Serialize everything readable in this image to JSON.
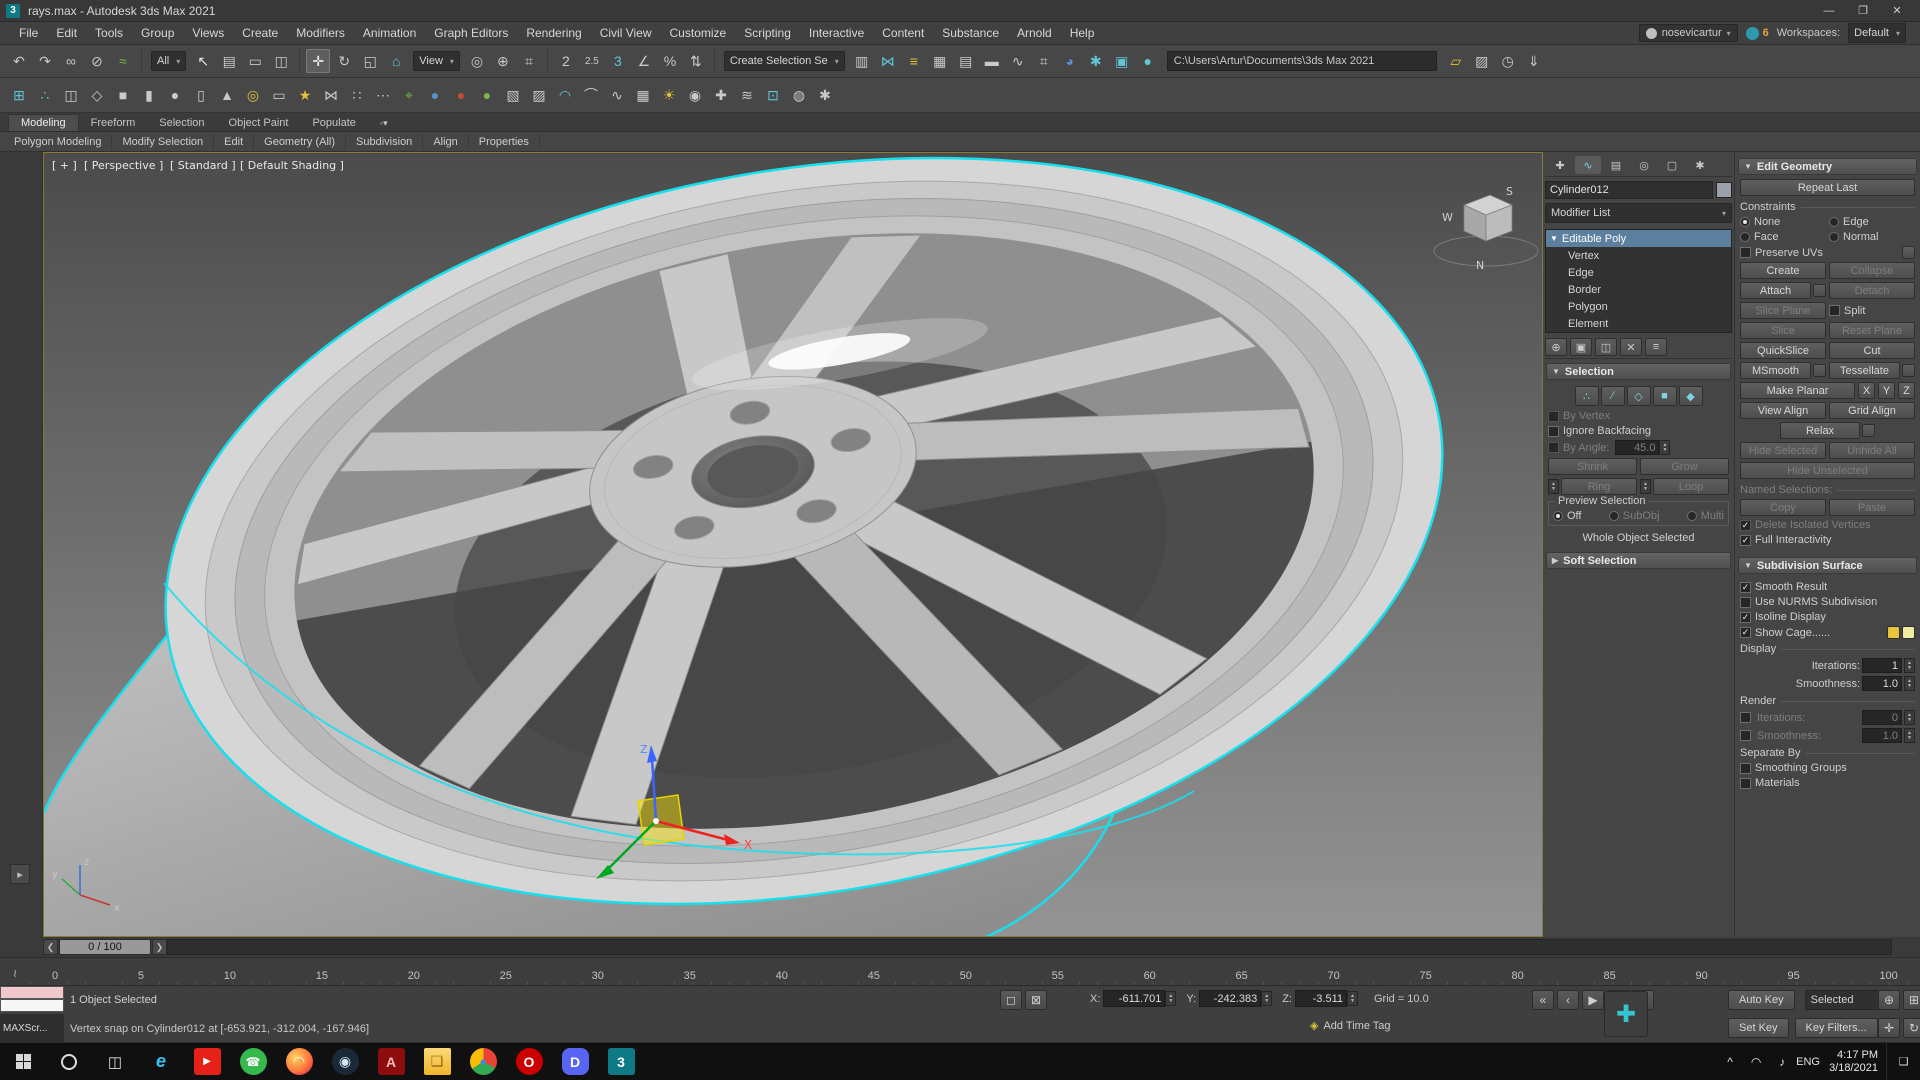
{
  "colors": {
    "accent_cyan": "#17e0ee",
    "autokey_red": "#b03030",
    "panel": "#454545"
  },
  "titlebar": {
    "title": "rays.max - Autodesk 3ds Max 2021",
    "app_glyph": "3",
    "min": "—",
    "max": "❐",
    "close": "✕"
  },
  "menubar": {
    "items": [
      {
        "n": "menu-file",
        "t": "File"
      },
      {
        "n": "menu-edit",
        "t": "Edit"
      },
      {
        "n": "menu-tools",
        "t": "Tools"
      },
      {
        "n": "menu-group",
        "t": "Group"
      },
      {
        "n": "menu-views",
        "t": "Views"
      },
      {
        "n": "menu-create",
        "t": "Create"
      },
      {
        "n": "menu-modifiers",
        "t": "Modifiers"
      },
      {
        "n": "menu-animation",
        "t": "Animation"
      },
      {
        "n": "menu-graph-editors",
        "t": "Graph Editors"
      },
      {
        "n": "menu-rendering",
        "t": "Rendering"
      },
      {
        "n": "menu-civil-view",
        "t": "Civil View"
      },
      {
        "n": "menu-customize",
        "t": "Customize"
      },
      {
        "n": "menu-scripting",
        "t": "Scripting"
      },
      {
        "n": "menu-interactive",
        "t": "Interactive"
      },
      {
        "n": "menu-content",
        "t": "Content"
      },
      {
        "n": "menu-substance",
        "t": "Substance"
      },
      {
        "n": "menu-arnold",
        "t": "Arnold"
      },
      {
        "n": "menu-help",
        "t": "Help"
      }
    ],
    "user": "nosevicartur",
    "user_arrow": "▾",
    "badge": "6",
    "workspaces_label": "Workspaces:",
    "workspace": "Default",
    "workspace_arrow": "▾"
  },
  "toolbar1": {
    "g1": [
      {
        "n": "undo-icon",
        "g": "↶"
      },
      {
        "n": "redo-icon",
        "g": "↷"
      },
      {
        "n": "select-and-link-icon",
        "g": "∞"
      },
      {
        "n": "unlink-selection-icon",
        "g": "⊘"
      },
      {
        "n": "bind-to-space-warp-icon",
        "g": "≈",
        "s": "color:#7ab648"
      }
    ],
    "filter_all": "All",
    "g2": [
      {
        "n": "select-object-icon",
        "g": "↖",
        "s": "color:#e8e8e8"
      },
      {
        "n": "select-by-name-icon",
        "g": "▤"
      },
      {
        "n": "rectangular-selection-region-icon",
        "g": "▭"
      },
      {
        "n": "window-crossing-toggle-icon",
        "g": "◫"
      }
    ],
    "g3": [
      {
        "n": "select-and-move-icon",
        "g": "✛",
        "s": "background:#5e5e5e;box-shadow:inset 0 0 0 1px #7a7a7a;color:#f0f0f0"
      },
      {
        "n": "select-and-rotate-icon",
        "g": "↻"
      },
      {
        "n": "select-and-scale-icon",
        "g": "◱"
      },
      {
        "n": "select-and-place-icon",
        "g": "⌂",
        "s": "color:#62c6d4"
      }
    ],
    "view_dd": "View",
    "g4": [
      {
        "n": "use-pivot-point-center-icon",
        "g": "◎"
      },
      {
        "n": "select-and-manipulate-icon",
        "g": "⊕"
      },
      {
        "n": "keyboard-shortcut-override-icon",
        "g": "⌗"
      }
    ],
    "g5": [
      {
        "n": "snaps-toggle-2d-icon",
        "g": "2"
      },
      {
        "n": "snaps-toggle-25d-icon",
        "g": "2.5",
        "s": "font-size:10px"
      },
      {
        "n": "snaps-toggle-3d-icon",
        "g": "3",
        "s": "color:#62c6d4"
      },
      {
        "n": "angle-snap-toggle-icon",
        "g": "∠"
      },
      {
        "n": "percent-snap-toggle-icon",
        "g": "%"
      },
      {
        "n": "spinner-snap-toggle-icon",
        "g": "⇅"
      }
    ],
    "create_selection_dd": "Create Selection Se",
    "g6": [
      {
        "n": "edit-named-selection-sets-icon",
        "g": "▥"
      },
      {
        "n": "mirror-icon",
        "g": "⋈",
        "s": "color:#62c6d4"
      },
      {
        "n": "align-icon",
        "g": "≡",
        "s": "color:#e0c23a"
      },
      {
        "n": "toggle-scene-explorer-icon",
        "g": "▦"
      },
      {
        "n": "toggle-layer-explorer-icon",
        "g": "▤"
      },
      {
        "n": "toggle-ribbon-icon",
        "g": "▬"
      },
      {
        "n": "curve-editor-icon",
        "g": "∿"
      },
      {
        "n": "schematic-view-icon",
        "g": "⌗"
      },
      {
        "n": "material-editor-icon",
        "g": "◕",
        "s": "color:#5d8fd0"
      },
      {
        "n": "render-setup-icon",
        "g": "✱",
        "s": "color:#62c6d4"
      },
      {
        "n": "rendered-frame-window-icon",
        "g": "▣",
        "s": "color:#62c6d4"
      },
      {
        "n": "render-production-icon",
        "g": "●",
        "s": "color:#62c6d4"
      }
    ],
    "path": "C:\\Users\\Artur\\Documents\\3ds Max 2021",
    "g7": [
      {
        "n": "project-folder-icon",
        "g": "▱",
        "s": "color:#e0c23a"
      },
      {
        "n": "asset-library-icon",
        "g": "▨"
      },
      {
        "n": "open-recent-icon",
        "g": "◷"
      },
      {
        "n": "save-scene-icon",
        "g": "⇓"
      }
    ]
  },
  "toolbar2": {
    "icons": [
      {
        "n": "snap-to-grid-icon",
        "g": "⊞",
        "s": "color:#62c6d4"
      },
      {
        "n": "snap-to-vertex-icon",
        "g": "∴",
        "s": "color:#62c6d4"
      },
      {
        "n": "viewport-layout-icon",
        "g": "◫"
      },
      {
        "n": "wireframe-toggle-icon",
        "g": "◇"
      },
      {
        "n": "box-primitive-icon",
        "g": "■"
      },
      {
        "n": "cylinder-primitive-icon",
        "g": "▮"
      },
      {
        "n": "sphere-primitive-icon",
        "g": "●"
      },
      {
        "n": "capsule-primitive-icon",
        "g": "▯"
      },
      {
        "n": "cone-primitive-icon",
        "g": "▲"
      },
      {
        "n": "torus-primitive-icon",
        "g": "◎",
        "s": "color:#e0c23a"
      },
      {
        "n": "plane-primitive-icon",
        "g": "▭"
      },
      {
        "n": "star-shape-icon",
        "g": "★",
        "s": "color:#e0c23a"
      },
      {
        "n": "mirror-modifier-icon",
        "g": "⋈"
      },
      {
        "n": "array-tool-icon",
        "g": "∷"
      },
      {
        "n": "spacing-tool-icon",
        "g": "⋯"
      },
      {
        "n": "measure-distance-icon",
        "g": "⌖",
        "s": "color:#7ab648"
      },
      {
        "n": "material-sample-blue-icon",
        "g": "●",
        "s": "color:#5d8fd0"
      },
      {
        "n": "material-sample-red-icon",
        "g": "●",
        "s": "color:#c34b3a"
      },
      {
        "n": "material-sample-green-icon",
        "g": "●",
        "s": "color:#7ab648"
      },
      {
        "n": "uvw-map-icon",
        "g": "▧"
      },
      {
        "n": "unwrap-uvw-icon",
        "g": "▨"
      },
      {
        "n": "smooth-modifier-icon",
        "g": "◠",
        "s": "color:#62c6d4"
      },
      {
        "n": "bend-modifier-icon",
        "g": "⌒"
      },
      {
        "n": "twist-modifier-icon",
        "g": "∿"
      },
      {
        "n": "lattice-modifier-icon",
        "g": "▦"
      },
      {
        "n": "light-create-icon",
        "g": "☀",
        "s": "color:#e0c23a"
      },
      {
        "n": "camera-create-icon",
        "g": "◉"
      },
      {
        "n": "helper-create-icon",
        "g": "✚"
      },
      {
        "n": "space-warp-icon",
        "g": "≋"
      },
      {
        "n": "render-region-icon",
        "g": "⊡",
        "s": "color:#62c6d4"
      },
      {
        "n": "environment-settings-icon",
        "g": "◍"
      },
      {
        "n": "viewport-config-icon",
        "g": "✱"
      }
    ]
  },
  "ribbon": {
    "tabs": [
      {
        "n": "ribbon-tab-modeling",
        "t": "Modeling",
        "s": "background:#4d4d4d;color:#eee;border:1px solid #333;border-bottom:none"
      },
      {
        "n": "ribbon-tab-freeform",
        "t": "Freeform"
      },
      {
        "n": "ribbon-tab-selection",
        "t": "Selection"
      },
      {
        "n": "ribbon-tab-object-paint",
        "t": "Object Paint"
      },
      {
        "n": "ribbon-tab-populate",
        "t": "Populate"
      }
    ],
    "options_glyph": "◦▾",
    "subtabs": [
      {
        "n": "ribbon-panel-polygon-modeling",
        "t": "Polygon Modeling"
      },
      {
        "n": "ribbon-panel-modify-selection",
        "t": "Modify Selection"
      },
      {
        "n": "ribbon-panel-edit",
        "t": "Edit"
      },
      {
        "n": "ribbon-panel-geometry-all",
        "t": "Geometry (All)"
      },
      {
        "n": "ribbon-panel-subdivision",
        "t": "Subdivision"
      },
      {
        "n": "ribbon-panel-align",
        "t": "Align"
      },
      {
        "n": "ribbon-panel-properties",
        "t": "Properties"
      }
    ]
  },
  "viewport": {
    "label_plus": "[ + ]",
    "label_camera": "[ Perspective ]",
    "label_renderer": "[ Standard ]",
    "label_shading": "[ Default Shading ]",
    "viewcube": {
      "w": "W",
      "n": "N",
      "s": "S"
    },
    "axis": {
      "x": "x",
      "y": "y",
      "z": "z"
    },
    "gizmo_x": "X",
    "gizmo_z": "Z"
  },
  "command_panel": {
    "tabs": [
      {
        "n": "create-tab-icon",
        "g": "✚"
      },
      {
        "n": "modify-tab-icon",
        "g": "∿",
        "s": "background:#5a5a5a;color:#7fd4e0"
      },
      {
        "n": "hierarchy-tab-icon",
        "g": "▤"
      },
      {
        "n": "motion-tab-icon",
        "g": "◎"
      },
      {
        "n": "display-tab-icon",
        "g": "▢"
      },
      {
        "n": "utilities-tab-icon",
        "g": "✱"
      }
    ],
    "object_name": "Cylinder012",
    "modifier_list": "Modifier List",
    "stack_root": "Editable Poly",
    "stack_sub": [
      "Vertex",
      "Edge",
      "Border",
      "Polygon",
      "Element"
    ],
    "stack_tools": [
      {
        "n": "pin-stack-icon",
        "g": "⊕"
      },
      {
        "n": "show-end-result-icon",
        "g": "▣"
      },
      {
        "n": "make-unique-icon",
        "g": "◫"
      },
      {
        "n": "remove-modifier-icon",
        "g": "✕"
      },
      {
        "n": "configure-modifier-sets-icon",
        "g": "≡"
      }
    ],
    "selection": {
      "title": "Selection",
      "sub_icons": [
        {
          "n": "vertex-mode-icon",
          "g": "∴"
        },
        {
          "n": "edge-mode-icon",
          "g": "∕"
        },
        {
          "n": "border-mode-icon",
          "g": "◇"
        },
        {
          "n": "polygon-mode-icon",
          "g": "■"
        },
        {
          "n": "element-mode-icon",
          "g": "◆"
        }
      ],
      "by_vertex": "By Vertex",
      "ignore_backfacing": "Ignore Backfacing",
      "by_angle": "By Angle:",
      "by_angle_value": "45.0",
      "shrink": "Shrink",
      "grow": "Grow",
      "ring": "Ring",
      "loop": "Loop",
      "preview": "Preview Selection",
      "off": "Off",
      "subobj": "SubObj",
      "multi": "Multi",
      "status": "Whole Object Selected"
    },
    "soft_selection": "Soft Selection",
    "edit_geometry": {
      "title": "Edit Geometry",
      "repeat_last": "Repeat Last",
      "constraints": "Constraints",
      "none": "None",
      "edge": "Edge",
      "face": "Face",
      "normal": "Normal",
      "preserve_uvs": "Preserve UVs",
      "create": "Create",
      "collapse": "Collapse",
      "attach": "Attach",
      "detach": "Detach",
      "slice_plane": "Slice Plane",
      "split": "Split",
      "slice": "Slice",
      "reset_plane": "Reset Plane",
      "quickslice": "QuickSlice",
      "cut": "Cut",
      "msmooth": "MSmooth",
      "tessellate": "Tessellate",
      "make_planar": "Make Planar",
      "x": "X",
      "y": "Y",
      "z": "Z",
      "view_align": "View Align",
      "grid_align": "Grid Align",
      "relax": "Relax",
      "hide_selected": "Hide Selected",
      "unhide_all": "Unhide All",
      "hide_unselected": "Hide Unselected",
      "named_selections": "Named Selections:",
      "copy": "Copy",
      "paste": "Paste",
      "delete_isolated": "Delete Isolated Vertices",
      "full_interactivity": "Full Interactivity"
    },
    "subdivision_surface": {
      "title": "Subdivision Surface",
      "smooth_result": "Smooth Result",
      "use_nurms": "Use NURMS Subdivision",
      "isoline": "Isoline Display",
      "show_cage": "Show Cage......",
      "display": "Display",
      "render": "Render",
      "iterations": "Iterations:",
      "smoothness": "Smoothness:",
      "display_iterations": "1",
      "display_smoothness": "1.0",
      "render_iterations": "0",
      "render_smoothness": "1.0",
      "separate_by": "Separate By",
      "smoothing_groups": "Smoothing Groups",
      "materials": "Materials",
      "cage_color_1": "#e8c43c",
      "cage_color_2": "#f0eba0"
    }
  },
  "timeline": {
    "frame": "0 / 100",
    "left_arrow": "❮",
    "right_arrow": "❯",
    "mce_glyph": "≀",
    "ticks": [
      "0",
      "5",
      "10",
      "15",
      "20",
      "25",
      "30",
      "35",
      "40",
      "45",
      "50",
      "55",
      "60",
      "65",
      "70",
      "75",
      "80",
      "85",
      "90",
      "95",
      "100"
    ]
  },
  "statusbar": {
    "maxscript": "MAXScr...",
    "selected": "1 Object Selected",
    "prompt": "Vertex snap on Cylinder012 at [-653.921, -312.004, -167.946]",
    "mid_icons": [
      {
        "n": "isolate-selection-toggle-icon",
        "g": "◻"
      },
      {
        "n": "selection-lock-toggle-icon",
        "g": "⊠"
      }
    ],
    "x_label": "X:",
    "x": "-611.701",
    "y_label": "Y:",
    "y": "-242.383",
    "z_label": "Z:",
    "z": "-3.511",
    "grid": "Grid = 10.0",
    "time_tag_glyph": "◈",
    "add_time_tag": "Add Time Tag",
    "playback": [
      {
        "n": "go-to-start-icon",
        "g": "«"
      },
      {
        "n": "previous-frame-icon",
        "g": "‹"
      },
      {
        "n": "play-animation-icon",
        "g": "▶"
      },
      {
        "n": "next-frame-icon",
        "g": "›"
      },
      {
        "n": "go-to-end-icon",
        "g": "»"
      }
    ],
    "key_plus_glyph": "✚",
    "auto_key": "Auto Key",
    "set_key": "Set Key",
    "selected_filter": "Selected",
    "selected_arrow": "▾",
    "key_filters": "Key Filters...",
    "nav_a": [
      {
        "n": "zoom-icon",
        "g": "⊕"
      },
      {
        "n": "zoom-all-icon",
        "g": "⊞"
      },
      {
        "n": "zoom-extents-icon",
        "g": "▣"
      },
      {
        "n": "field-of-view-icon",
        "g": "∠"
      }
    ],
    "nav_b": [
      {
        "n": "pan-view-icon",
        "g": "✛"
      },
      {
        "n": "orbit-icon",
        "g": "↻"
      },
      {
        "n": "zoom-region-icon",
        "g": "⊡"
      },
      {
        "n": "maximize-viewport-toggle-icon",
        "g": "◱"
      }
    ]
  },
  "taskbar": {
    "apps": [
      {
        "n": "microsoft-edge-icon",
        "g": "e",
        "s": "color:#35c1f1;font-weight:bold;font-size:18px;font-style:italic"
      },
      {
        "n": "youtube-icon",
        "g": "▶",
        "s": "background:#e62117;color:#fff;font-size:10px"
      },
      {
        "n": "whatsapp-icon",
        "g": "☎",
        "s": "background:#35b94c;color:#fff;border-radius:50%;font-size:12px"
      },
      {
        "n": "firefox-icon",
        "g": "◠",
        "s": "background:radial-gradient(circle at 35% 35%,#ffd35e,#ff7139 60%,#b5007f);color:#fff;border-radius:50%"
      },
      {
        "n": "steam-icon",
        "g": "◉",
        "s": "background:#1b2838;color:#cfe6f5;border-radius:50%"
      },
      {
        "n": "adobe-icon",
        "g": "A",
        "s": "background:#8d0d0d;color:#ffb8b8;font-weight:bold"
      },
      {
        "n": "file-explorer-icon",
        "g": "❏",
        "s": "background:linear-gradient(#ffd978,#f0b429);color:#8a6a10;border-radius:2px"
      },
      {
        "n": "chrome-icon",
        "g": "●",
        "s": "background:conic-gradient(#ea4335 0 33%,#34a853 33% 66%,#fbbc05 66% 100%);color:#4285f4;border-radius:50%;font-size:11px"
      },
      {
        "n": "opera-icon",
        "g": "O",
        "s": "background:#c00;color:#fff;border-radius:50%;font-weight:bold"
      },
      {
        "n": "discord-icon",
        "g": "D",
        "s": "background:#5865f2;color:#fff;border-radius:8px;font-weight:bold"
      },
      {
        "n": "3ds-max-icon",
        "g": "3",
        "s": "background:#0e7a86;color:#fff;font-weight:bold",
        "active": true
      }
    ],
    "tray_chevron": "^",
    "lang": "ENG",
    "time": "4:17 PM",
    "date": "3/18/2021",
    "wifi_glyph": "◠",
    "speaker_glyph": "♪",
    "notif_glyph": "❑",
    "search_glyph": "○",
    "taskview_glyph": "◫"
  }
}
